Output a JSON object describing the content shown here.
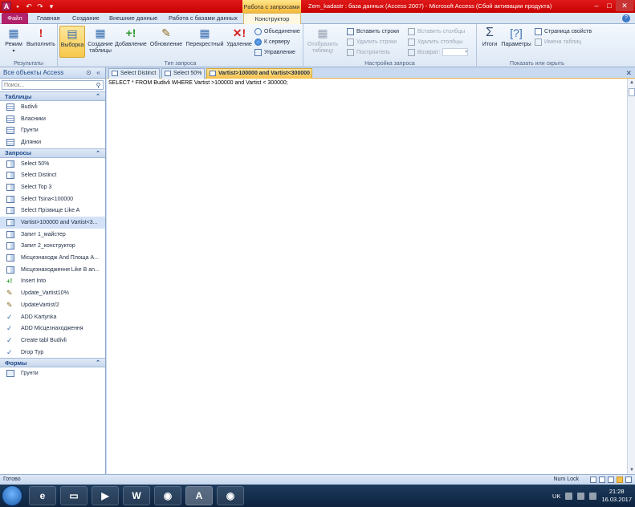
{
  "titlebar": {
    "context_tab": "Работа с запросами",
    "title": "Zem_kadastr : база данных (Access 2007) - Microsoft Access (Сбой активации продукта)",
    "app_logo": "A"
  },
  "ribbon_tabs": {
    "file": "Файл",
    "home": "Главная",
    "create": "Создание",
    "external": "Внешние данные",
    "dbtools": "Работа с базами данных",
    "designer": "Конструктор"
  },
  "ribbon": {
    "results": {
      "label": "Результаты",
      "view": "Режим",
      "run": "Выполнить"
    },
    "query_type": {
      "label": "Тип запроса",
      "select": "Выборка",
      "make_table": "Создание таблицы",
      "append": "Добавление",
      "update": "Обновление",
      "crosstab": "Перекрестный",
      "delete": "Удаление",
      "union": "Объединение",
      "pass_through": "К серверу",
      "data_def": "Управление"
    },
    "query_setup": {
      "label": "Настройка запроса",
      "show_table": "Отобразить таблицу",
      "insert_rows": "Вставить строки",
      "delete_rows": "Удалить строки",
      "builder": "Построитель",
      "insert_cols": "Вставить столбцы",
      "delete_cols": "Удалить столбцы",
      "return": "Возврат:"
    },
    "show_hide": {
      "label": "Показать или скрыть",
      "totals": "Итоги",
      "parameters": "Параметры",
      "property_sheet": "Страница свойств",
      "table_names": "Имена таблиц"
    }
  },
  "nav": {
    "header": "Все объекты Access",
    "search_placeholder": "Поиск...",
    "sections": {
      "tables": "Таблицы",
      "queries": "Запросы",
      "forms": "Формы"
    },
    "tables": [
      "Budivli",
      "Власники",
      "Грунти",
      "Ділянки"
    ],
    "queries": [
      "Select 50%",
      "Select Distinct",
      "Select Top 3",
      "Select Tsina<100000",
      "Select Прізвище Like A",
      "Vartist>100000 and Vartist<3...",
      "Запит 1_майстер",
      "Запит 2_конструктор",
      "Місцезнаходж And Площа A...",
      "Місцезнаходження Like B an...",
      "Insert Into",
      "Update_Vartist10%",
      "UpdateVartist/2",
      "ADD Kartynka",
      "ADD Місцезнаходження",
      "Create tabl Budivli",
      "Drop Typ"
    ],
    "forms": [
      "Грунти"
    ]
  },
  "doc": {
    "tabs": [
      "Select Distinct",
      "Select 50%",
      "Vartist>100000 and Vartist<300000"
    ],
    "sql": "SELECT * FROM Budivli WHERE Vartist >100000 and Vartist < 300000;"
  },
  "status": {
    "text": "Готово",
    "numlock": "Num Lock"
  },
  "taskbar": {
    "lang": "UK",
    "time": "21:28",
    "date": "16.03.2017"
  }
}
